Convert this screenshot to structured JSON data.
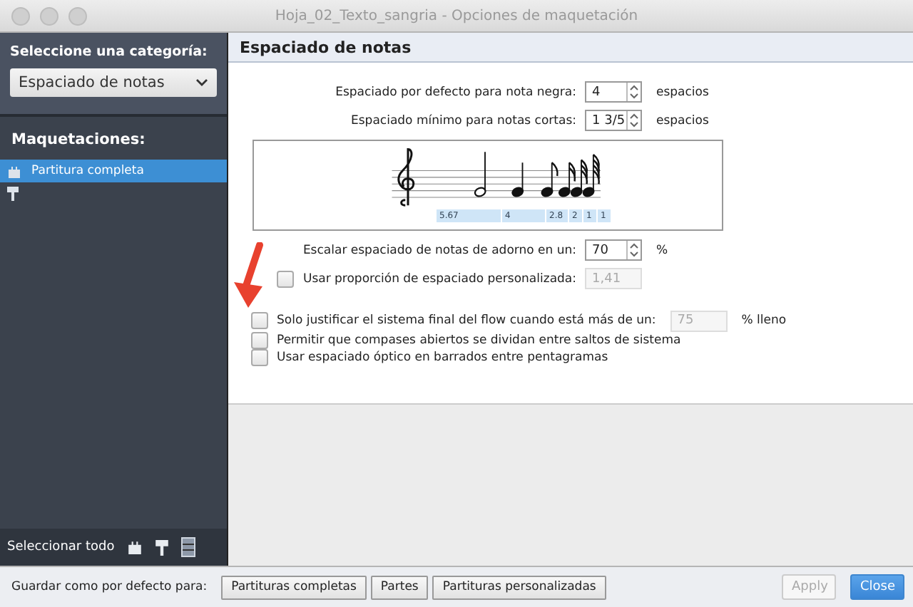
{
  "window": {
    "title": "Hoja_02_Texto_sangria - Opciones de maquetación"
  },
  "sidebar": {
    "category_label": "Seleccione una categoría:",
    "category_value": "Espaciado de notas",
    "layouts_label": "Maquetaciones:",
    "layouts": [
      {
        "kind": "full-score",
        "label": "Partitura completa",
        "selected": true
      },
      {
        "kind": "part",
        "selected": false
      }
    ],
    "select_all": "Seleccionar todo"
  },
  "main": {
    "title": "Espaciado de notas",
    "fields": [
      {
        "label": "Espaciado por defecto para nota negra:",
        "value": "4",
        "unit": "espacios"
      },
      {
        "label": "Espaciado mínimo para notas cortas:",
        "value": "1 3/5",
        "unit": "espacios"
      }
    ],
    "preview_spacings": [
      "5.67",
      "4",
      "2.8",
      "2",
      "1",
      "1"
    ],
    "grace": {
      "label": "Escalar espaciado de notas de adorno en un:",
      "value": "70",
      "unit": "%"
    },
    "custom_ratio": {
      "label": "Usar proporción de espaciado personalizada:",
      "checked": false,
      "value": "1,41"
    },
    "justify": {
      "label": "Solo justificar el sistema final del flow cuando está más de un:",
      "checked": false,
      "value": "75",
      "unit": "% lleno"
    },
    "options": [
      {
        "label": "Permitir que compases abiertos se dividan entre saltos de sistema",
        "checked": false
      },
      {
        "label": "Usar espaciado óptico en barrados entre pentagramas",
        "checked": false
      }
    ]
  },
  "footer": {
    "label": "Guardar como por defecto para:",
    "save_buttons": [
      "Partituras completas",
      "Partes",
      "Partituras personalizadas"
    ],
    "actions": [
      {
        "label": "Apply",
        "kind": "secondary",
        "disabled": true
      },
      {
        "label": "Close",
        "kind": "primary",
        "disabled": false
      }
    ]
  }
}
